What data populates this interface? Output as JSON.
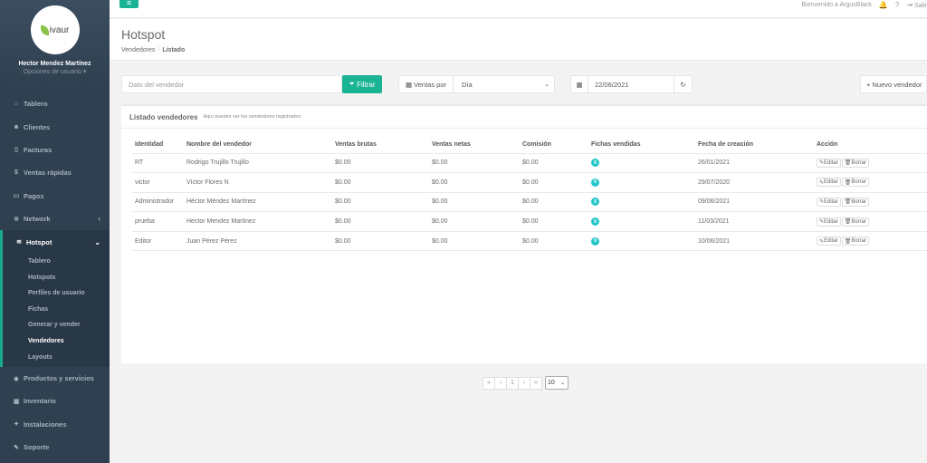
{
  "sidebar": {
    "logo_text": "ivaur",
    "user_name": "Hector Mendez Martínez",
    "user_options": "Opciones de usuario ▾",
    "items": [
      {
        "label": "Tablero",
        "icon": "dashboard-icon",
        "glyph": "⌂"
      },
      {
        "label": "Clientes",
        "icon": "users-icon",
        "glyph": "👥"
      },
      {
        "label": "Facturas",
        "icon": "file-icon",
        "glyph": "🗋"
      },
      {
        "label": "Ventas rápidas",
        "icon": "dollar-icon",
        "glyph": "$"
      },
      {
        "label": "Pagos",
        "icon": "money-icon",
        "glyph": "▭"
      },
      {
        "label": "Network",
        "icon": "network-icon",
        "glyph": "✲"
      },
      {
        "label": "Hotspot",
        "icon": "wifi-icon",
        "glyph": "≋"
      }
    ],
    "hotspot_sub": [
      "Tablero",
      "Hotspots",
      "Perfiles de usuario",
      "Fichas",
      "Generar y vender",
      "Vendedores",
      "Layouts"
    ],
    "bottom_items": [
      {
        "label": "Productos y servicios",
        "icon": "tag-icon",
        "glyph": "◆"
      },
      {
        "label": "Inventario",
        "icon": "cubes-icon",
        "glyph": "▣"
      },
      {
        "label": "Instalaciones",
        "icon": "tools-icon",
        "glyph": "✦"
      },
      {
        "label": "Soporte",
        "icon": "wrench-icon",
        "glyph": "✎"
      }
    ]
  },
  "topbar": {
    "welcome": "Bienvenido a ArgusBlack",
    "logout": "Salir"
  },
  "heading": {
    "title": "Hotspot",
    "crumb1": "Vendedores",
    "crumb2": "Listado"
  },
  "toolbar": {
    "search_placeholder": "Dato del vendedor",
    "filter_label": "Filtrar",
    "sales_by_label": "Ventas por",
    "period_value": "Día",
    "date_value": "22/06/2021",
    "new_seller_label": "Nuevo vendedor"
  },
  "panel": {
    "title": "Listado vendedores",
    "subtitle": "Aquí puedes ver los vendedores registrados"
  },
  "table": {
    "headers": [
      "Identidad",
      "Nombre del vendedor",
      "Ventas brutas",
      "Ventas netas",
      "Comisión",
      "Fichas vendidas",
      "Fecha de creación",
      "Acción"
    ],
    "rows": [
      {
        "id": "RT",
        "name": "Rodrigo Trujillo Trujillo",
        "gross": "$0.00",
        "net": "$0.00",
        "commission": "$0.00",
        "sold": "0",
        "created": "26/01/2021"
      },
      {
        "id": "victor",
        "name": "Víctor Flores N",
        "gross": "$0.00",
        "net": "$0.00",
        "commission": "$0.00",
        "sold": "0",
        "created": "29/07/2020"
      },
      {
        "id": "Administrador",
        "name": "Héctor Méndez Martínez",
        "gross": "$0.00",
        "net": "$0.00",
        "commission": "$0.00",
        "sold": "0",
        "created": "09/06/2021"
      },
      {
        "id": "prueba",
        "name": "Hector Mendez Martinez",
        "gross": "$0.00",
        "net": "$0.00",
        "commission": "$0.00",
        "sold": "0",
        "created": "11/03/2021"
      },
      {
        "id": "Editor",
        "name": "Juan Pérez Pérez",
        "gross": "$0.00",
        "net": "$0.00",
        "commission": "$0.00",
        "sold": "0",
        "created": "10/06/2021"
      }
    ],
    "edit_label": "Editar",
    "delete_label": "Borrar"
  },
  "pagination": {
    "first": "«",
    "prev": "‹",
    "page": "1",
    "next": "›",
    "last": "»",
    "per_page": "10"
  },
  "colors": {
    "primary": "#1ab394",
    "sidebar": "#2f4050",
    "badge": "#23c6c8"
  }
}
